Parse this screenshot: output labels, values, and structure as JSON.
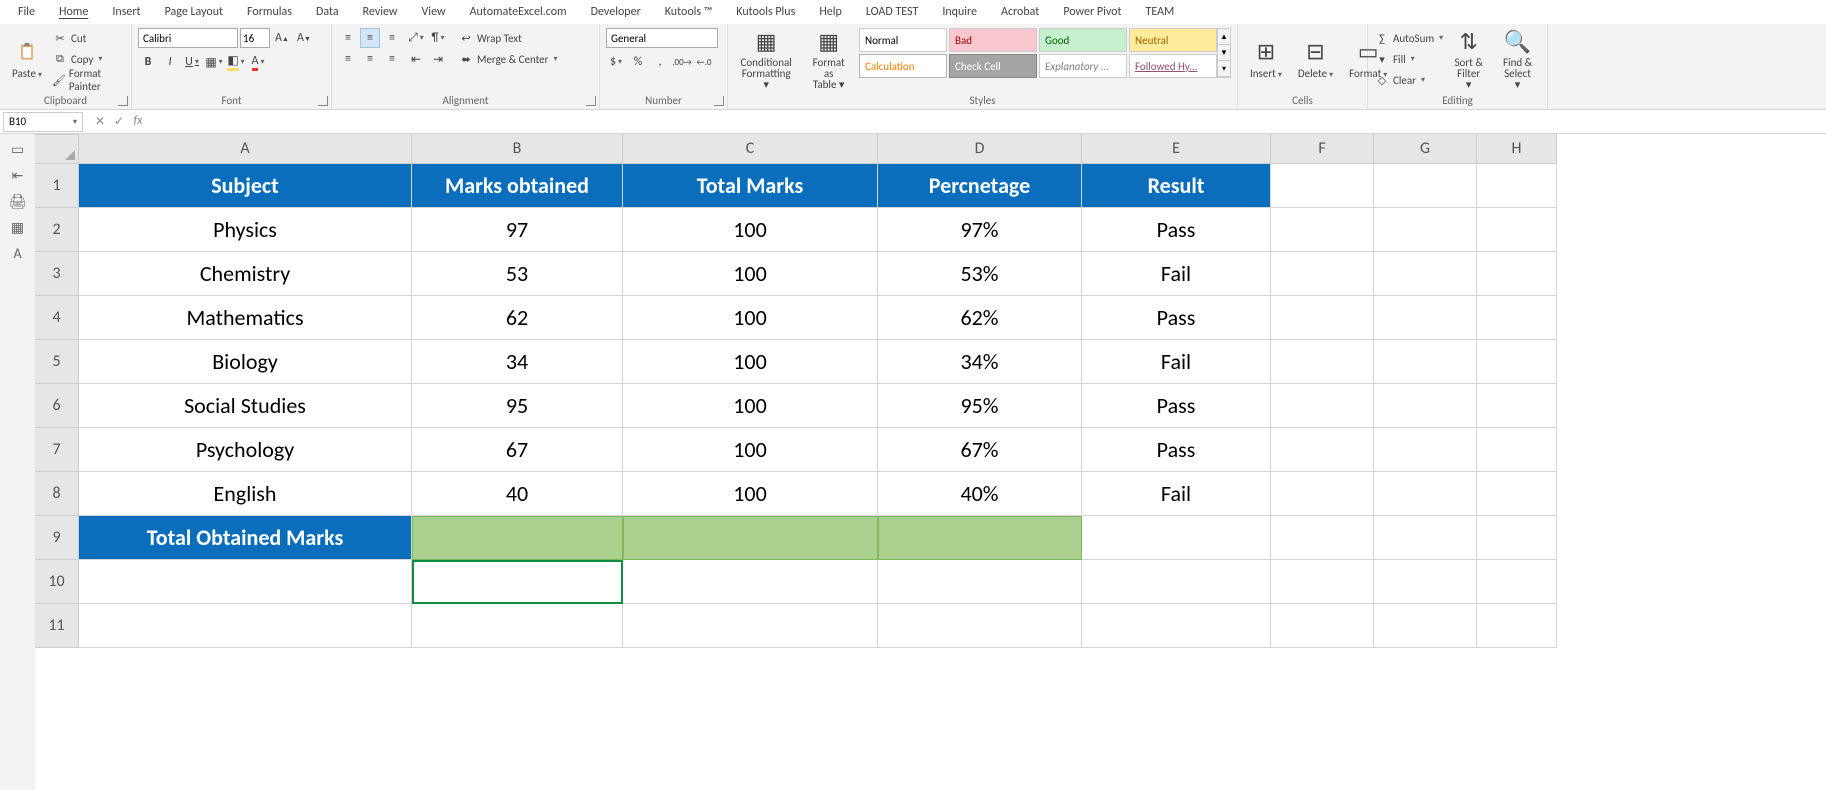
{
  "tabs": {
    "file": "File",
    "home": "Home",
    "insert": "Insert",
    "pageLayout": "Page Layout",
    "formulas": "Formulas",
    "data": "Data",
    "review": "Review",
    "view": "View",
    "automate": "AutomateExcel.com",
    "developer": "Developer",
    "kutools": "Kutools ™",
    "kutoolsPlus": "Kutools Plus",
    "help": "Help",
    "loadTest": "LOAD TEST",
    "inquire": "Inquire",
    "acrobat": "Acrobat",
    "powerPivot": "Power Pivot",
    "team": "TEAM"
  },
  "clipboard": {
    "paste": "Paste",
    "cut": "Cut",
    "copy": "Copy",
    "formatPainter": "Format Painter",
    "group": "Clipboard"
  },
  "font": {
    "name": "Calibri",
    "size": "16",
    "bold": "B",
    "italic": "I",
    "underline": "U",
    "group": "Font"
  },
  "alignment": {
    "wrap": "Wrap Text",
    "merge": "Merge & Center",
    "group": "Alignment"
  },
  "number": {
    "format": "General",
    "group": "Number"
  },
  "stylesGroup": {
    "cond": "Conditional",
    "cond2": "Formatting",
    "fmtTbl": "Format as",
    "fmtTbl2": "Table",
    "normal": "Normal",
    "bad": "Bad",
    "good": "Good",
    "neutral": "Neutral",
    "calc": "Calculation",
    "check": "Check Cell",
    "expl": "Explanatory ...",
    "link": "Followed Hy...",
    "group": "Styles"
  },
  "cells": {
    "insert": "Insert",
    "delete": "Delete",
    "format": "Format",
    "group": "Cells"
  },
  "editing": {
    "autosum": "AutoSum",
    "fill": "Fill",
    "clear": "Clear",
    "sort": "Sort &",
    "sort2": "Filter",
    "find": "Find &",
    "find2": "Select",
    "group": "Editing"
  },
  "nameBox": "B10",
  "formulaBar": "",
  "columns": [
    "A",
    "B",
    "C",
    "D",
    "E",
    "F",
    "G",
    "H"
  ],
  "rows": [
    "1",
    "2",
    "3",
    "4",
    "5",
    "6",
    "7",
    "8",
    "9",
    "10",
    "11"
  ],
  "sheet": {
    "headers": {
      "A": "Subject",
      "B": "Marks obtained",
      "C": "Total Marks",
      "D": "Percnetage",
      "E": "Result"
    },
    "data": [
      {
        "A": "Physics",
        "B": "97",
        "C": "100",
        "D": "97%",
        "E": "Pass"
      },
      {
        "A": "Chemistry",
        "B": "53",
        "C": "100",
        "D": "53%",
        "E": "Fail"
      },
      {
        "A": "Mathematics",
        "B": "62",
        "C": "100",
        "D": "62%",
        "E": "Pass"
      },
      {
        "A": "Biology",
        "B": "34",
        "C": "100",
        "D": "34%",
        "E": "Fail"
      },
      {
        "A": "Social Studies",
        "B": "95",
        "C": "100",
        "D": "95%",
        "E": "Pass"
      },
      {
        "A": "Psychology",
        "B": "67",
        "C": "100",
        "D": "67%",
        "E": "Pass"
      },
      {
        "A": "English",
        "B": "40",
        "C": "100",
        "D": "40%",
        "E": "Fail"
      }
    ],
    "totalRow": {
      "A": "Total Obtained Marks"
    }
  }
}
